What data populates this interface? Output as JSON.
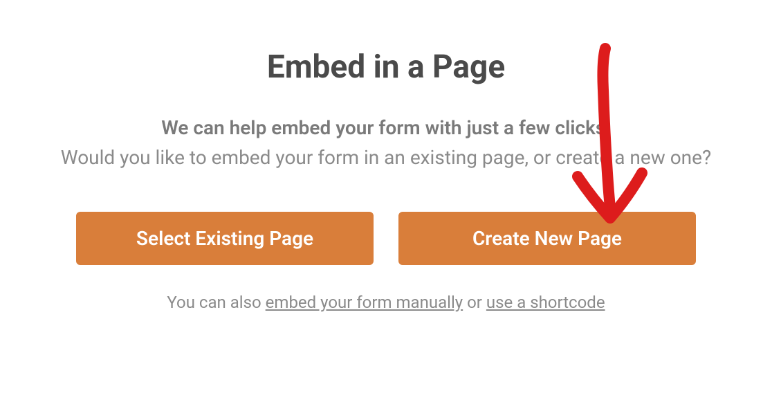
{
  "modal": {
    "title": "Embed in a Page",
    "subtitle_bold": "We can help embed your form with just a few clicks!",
    "subtitle_light": "Would you like to embed your form in an existing page, or create a new one?",
    "buttons": {
      "select_existing": "Select Existing Page",
      "create_new": "Create New Page"
    },
    "footer": {
      "prefix": "You can also ",
      "link1": "embed your form manually",
      "middle": " or ",
      "link2": "use a shortcode"
    }
  }
}
